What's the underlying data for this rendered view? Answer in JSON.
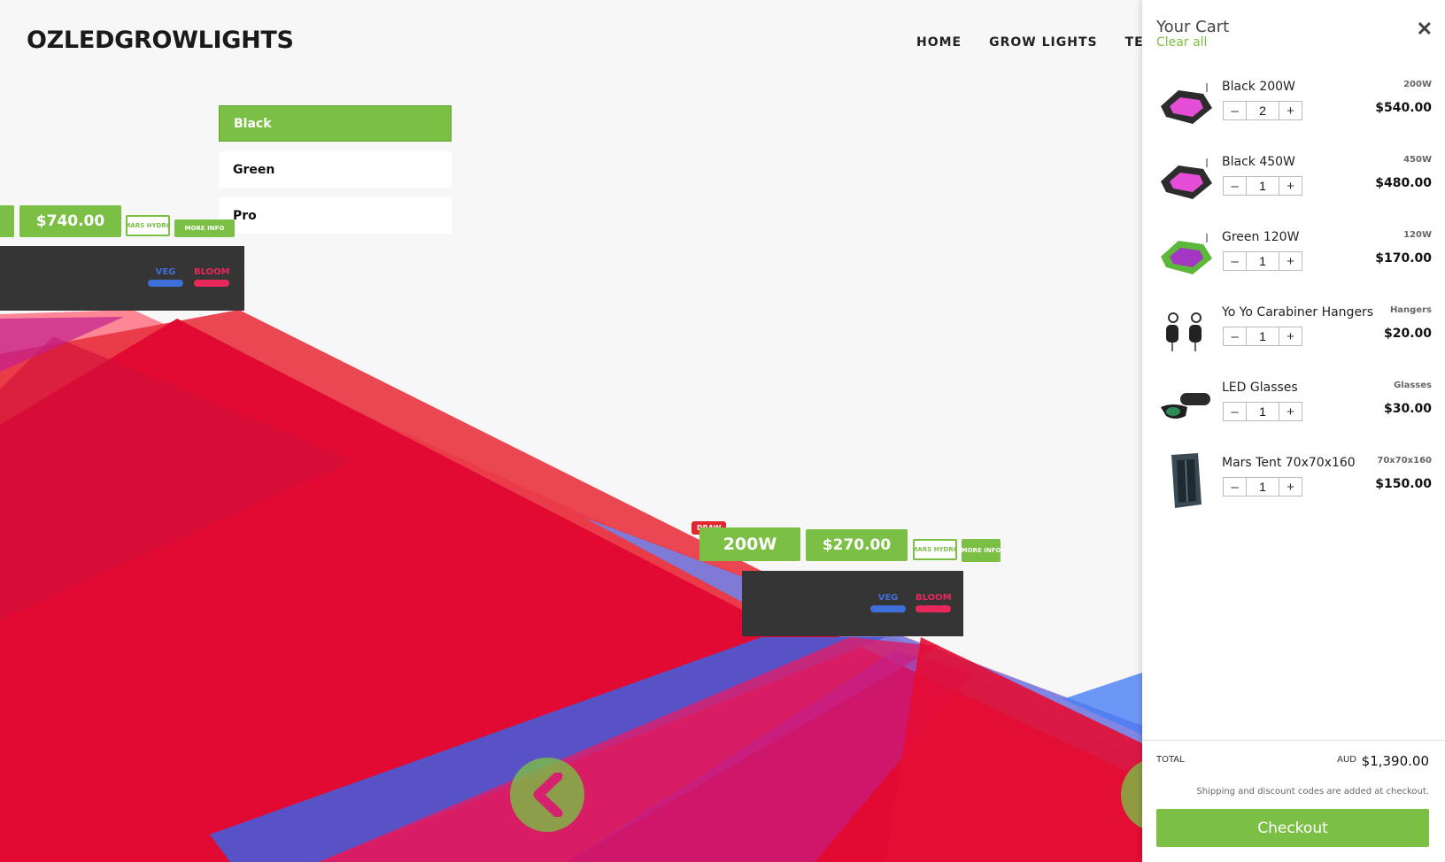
{
  "brand": {
    "logo": "OZLEDGROWLIGHTS",
    "accent": "#7bbf45"
  },
  "nav": {
    "items": [
      "HOME",
      "GROW LIGHTS",
      "TEN"
    ]
  },
  "dropdown": {
    "options": [
      "Black",
      "Green",
      "Pro"
    ],
    "selected": "Black"
  },
  "product_left": {
    "price": "$740.00",
    "brand_tag": "MARS HYDRO",
    "more_info": "MORE INFO",
    "veg_label": "VEG",
    "bloom_label": "BLOOM"
  },
  "product_center": {
    "badge": "DRAW",
    "wattage": "200W",
    "price": "$270.00",
    "brand_tag": "MARS HYDRO",
    "more_info": "MORE INFO",
    "veg_label": "VEG",
    "bloom_label": "BLOOM"
  },
  "colors": {
    "veg": "#3f6fd8",
    "bloom": "#e8275a",
    "panel": "#353535",
    "bg_red": "#e3152f"
  },
  "cart": {
    "title": "Your Cart",
    "clear_label": "Clear all",
    "close_icon": "close-icon",
    "items": [
      {
        "name": "Black 200W",
        "variant": "200W",
        "qty": "2",
        "price": "$540.00",
        "thumb": "led-panel-black"
      },
      {
        "name": "Black 450W",
        "variant": "450W",
        "qty": "1",
        "price": "$480.00",
        "thumb": "led-panel-black"
      },
      {
        "name": "Green 120W",
        "variant": "120W",
        "qty": "1",
        "price": "$170.00",
        "thumb": "led-panel-green"
      },
      {
        "name": "Yo Yo Carabiner Hangers",
        "variant": "Hangers",
        "qty": "1",
        "price": "$20.00",
        "thumb": "hangers"
      },
      {
        "name": "LED Glasses",
        "variant": "Glasses",
        "qty": "1",
        "price": "$30.00",
        "thumb": "glasses"
      },
      {
        "name": "Mars Tent 70x70x160",
        "variant": "70x70x160",
        "qty": "1",
        "price": "$150.00",
        "thumb": "tent"
      }
    ],
    "total_label": "TOTAL",
    "currency": "AUD",
    "total": "$1,390.00",
    "shipping_note": "Shipping and discount codes are added at checkout.",
    "checkout_label": "Checkout"
  }
}
